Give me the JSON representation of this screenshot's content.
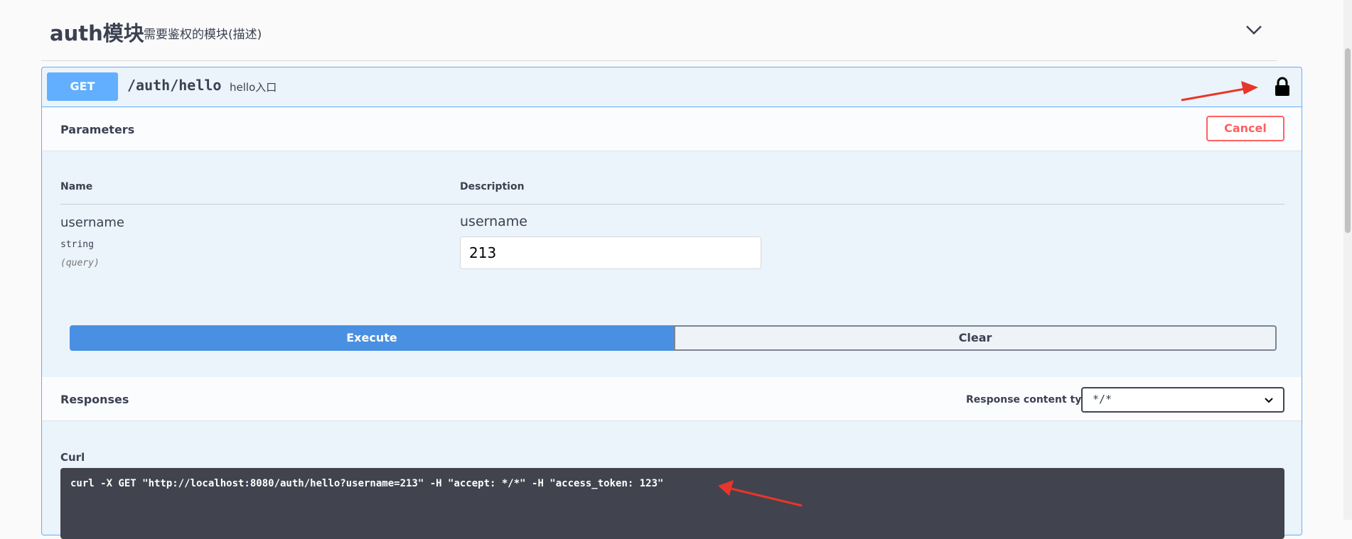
{
  "tag": {
    "title": "auth模块",
    "description": "需要鉴权的模块(描述)"
  },
  "operation": {
    "method": "GET",
    "path": "/auth/hello",
    "summary": "hello入口",
    "method_color": "#61affe"
  },
  "parameters": {
    "title": "Parameters",
    "cancel_label": "Cancel",
    "name_header": "Name",
    "description_header": "Description",
    "items": [
      {
        "name": "username",
        "type": "string",
        "in": "(query)",
        "description": "username",
        "value": "213"
      }
    ]
  },
  "actions": {
    "execute_label": "Execute",
    "clear_label": "Clear"
  },
  "responses": {
    "title": "Responses",
    "content_type_label": "Response content type",
    "content_type_value": "*/*"
  },
  "curl": {
    "label": "Curl",
    "command": "curl -X GET \"http://localhost:8080/auth/hello?username=213\" -H \"accept: */*\" -H \"access_token: 123\""
  },
  "icons": {
    "collapse": "chevron-down-icon",
    "lock": "lock-icon",
    "select": "chevron-down-icon"
  },
  "colors": {
    "accent": "#61affe",
    "execute": "#4990e2",
    "cancel": "#ff6060",
    "annotation_arrow": "#e8352b"
  }
}
